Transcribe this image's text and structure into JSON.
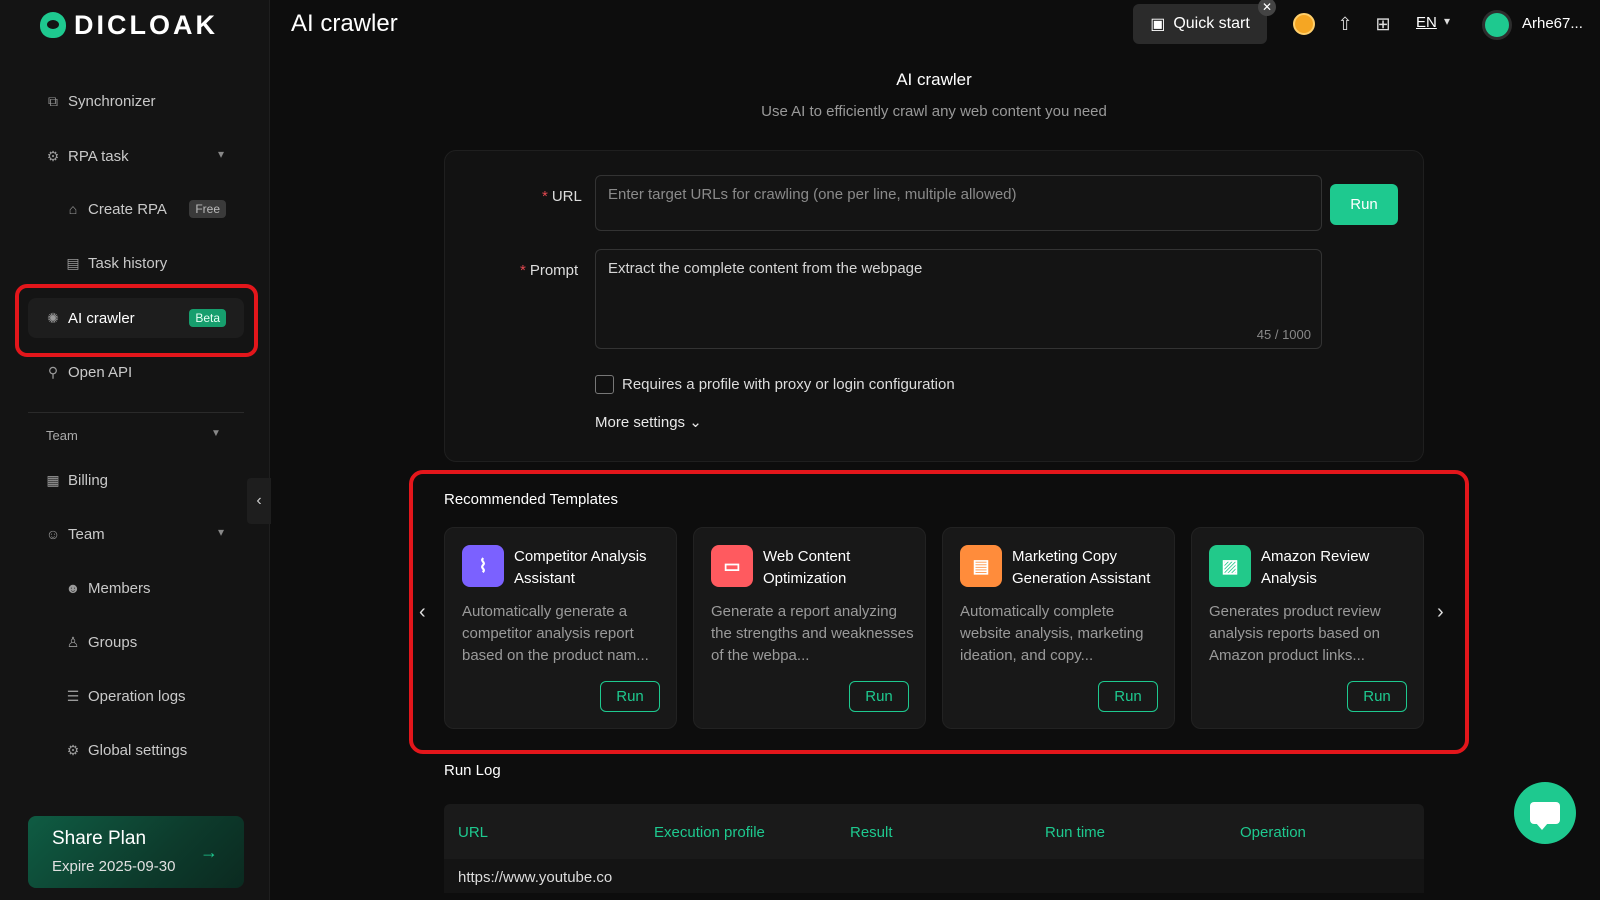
{
  "brand": {
    "name": "DICLOAK"
  },
  "sidebar": {
    "items": [
      {
        "label": "Synchronizer"
      },
      {
        "label": "RPA task"
      },
      {
        "label": "Create RPA",
        "badge": "Free"
      },
      {
        "label": "Task history"
      },
      {
        "label": "AI crawler",
        "badge": "Beta"
      },
      {
        "label": "Open API"
      }
    ],
    "section_label": "Team",
    "team_items": [
      {
        "label": "Billing"
      },
      {
        "label": "Team"
      },
      {
        "label": "Members"
      },
      {
        "label": "Groups"
      },
      {
        "label": "Operation logs"
      },
      {
        "label": "Global settings"
      }
    ],
    "share_plan": {
      "title": "Share Plan",
      "expire": "Expire 2025-09-30"
    }
  },
  "header": {
    "title": "AI crawler",
    "quick_start": "Quick start",
    "language": "EN",
    "username": "Arhe67..."
  },
  "main": {
    "title": "AI crawler",
    "subtitle": "Use AI to efficiently crawl any web content you need",
    "url_label": "URL",
    "url_placeholder": "Enter target URLs for crawling (one per line, multiple allowed)",
    "run_label": "Run",
    "prompt_label": "Prompt",
    "prompt_value": "Extract the complete content from the webpage",
    "prompt_counter": "45 / 1000",
    "checkbox_label": "Requires a profile with proxy or login configuration",
    "more_settings": "More settings"
  },
  "templates": {
    "title": "Recommended Templates",
    "items": [
      {
        "title": "Competitor Analysis Assistant",
        "desc": "Automatically generate a competitor analysis report based on the product nam...",
        "run": "Run",
        "color": "#7b61ff"
      },
      {
        "title": "Web Content Optimization",
        "desc": "Generate a report analyzing the strengths and weaknesses of the webpa...",
        "run": "Run",
        "color": "#ff5a5f"
      },
      {
        "title": "Marketing Copy Generation Assistant",
        "desc": "Automatically complete website analysis, marketing ideation, and copy...",
        "run": "Run",
        "color": "#ff8c3b"
      },
      {
        "title": "Amazon Review Analysis",
        "desc": "Generates product review analysis reports based on Amazon product links...",
        "run": "Run",
        "color": "#22c98a"
      }
    ]
  },
  "run_log": {
    "title": "Run Log",
    "columns": [
      "URL",
      "Execution profile",
      "Result",
      "Run time",
      "Operation"
    ],
    "rows": [
      {
        "url": "https://www.youtube.co"
      }
    ]
  },
  "colors": {
    "accent": "#1ec98f",
    "highlight": "#e3161b"
  }
}
